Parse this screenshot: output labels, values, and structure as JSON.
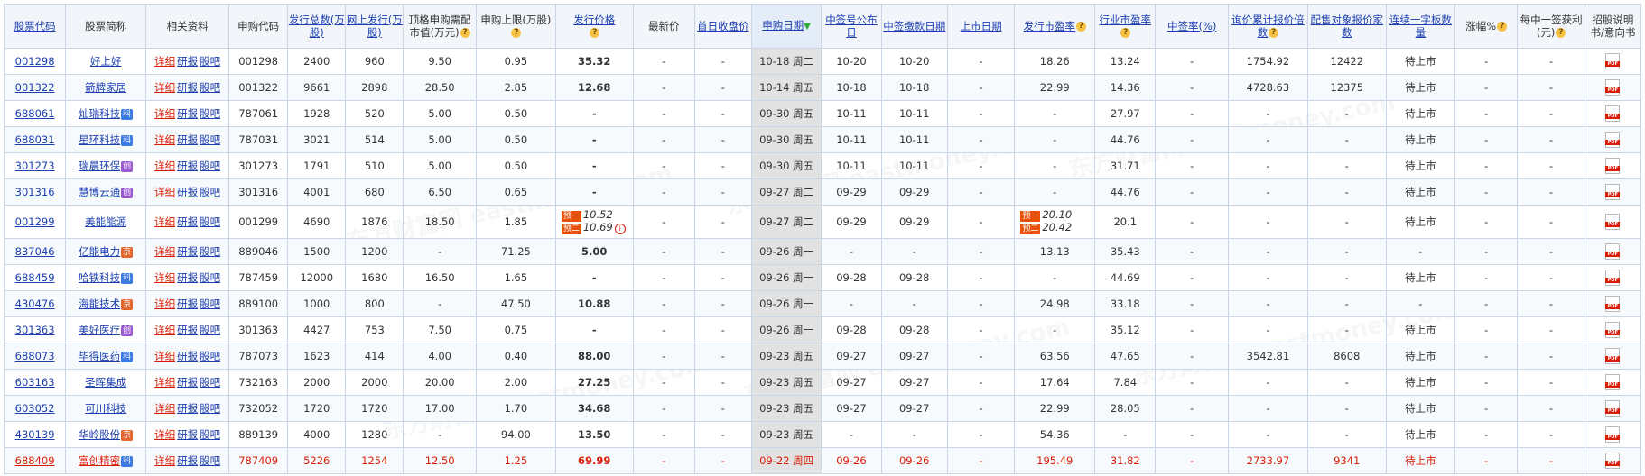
{
  "header": {
    "code": "股票代码",
    "name": "股票简称",
    "related": "相关资料",
    "sub_code": "申购代码",
    "issue_total": "发行总数(万股)",
    "online_issue": "网上发行(万股)",
    "top_sub_mv": "顶格申购需配市值(万元)",
    "sub_limit": "申购上限(万股)",
    "issue_price": "发行价格",
    "latest_price": "最新价",
    "first_close": "首日收盘价",
    "sub_date": "申购日期",
    "lot_pub_date": "中签号公布日",
    "pay_date": "中签缴款日期",
    "list_date": "上市日期",
    "issue_pe": "发行市盈率",
    "industry_pe": "行业市盈率",
    "lot_rate": "中签率(%)",
    "inquiry_mult": "询价累计报价倍数",
    "placement_count": "配售对象报价家数",
    "limit_boards": "连续一字板数量",
    "change_pct": "涨幅%",
    "profit_per_lot": "每中一签获利(元)",
    "prospectus": "招股说明书/意向书"
  },
  "related_links": {
    "detail": "详细",
    "report": "研报",
    "forum": "股吧"
  },
  "watermark": "东方财富网 eastmoney.com",
  "rows": [
    {
      "code": "001298",
      "name": "好上好",
      "tag": "",
      "sub": "001298",
      "total": "2400",
      "online": "960",
      "mv": "9.50",
      "limit": "0.95",
      "price": "35.32",
      "latest": "-",
      "first": "-",
      "date": "10-18 周二",
      "pub": "10-20",
      "pay": "10-20",
      "list": "-",
      "pe": "18.26",
      "ipe": "13.24",
      "rate": "-",
      "mult": "1754.92",
      "count": "12422",
      "boards": "待上市",
      "chg": "-",
      "profit": "-"
    },
    {
      "code": "001322",
      "name": "箭牌家居",
      "tag": "",
      "sub": "001322",
      "total": "9661",
      "online": "2898",
      "mv": "28.50",
      "limit": "2.85",
      "price": "12.68",
      "latest": "-",
      "first": "-",
      "date": "10-14 周五",
      "pub": "10-18",
      "pay": "10-18",
      "list": "-",
      "pe": "22.99",
      "ipe": "14.36",
      "rate": "-",
      "mult": "4728.63",
      "count": "12375",
      "boards": "待上市",
      "chg": "-",
      "profit": "-"
    },
    {
      "code": "688061",
      "name": "灿瑞科技",
      "tag": "科",
      "sub": "787061",
      "total": "1928",
      "online": "520",
      "mv": "5.00",
      "limit": "0.50",
      "price": "-",
      "latest": "-",
      "first": "-",
      "date": "09-30 周五",
      "pub": "10-11",
      "pay": "10-11",
      "list": "-",
      "pe": "-",
      "ipe": "27.97",
      "rate": "-",
      "mult": "-",
      "count": "-",
      "boards": "待上市",
      "chg": "-",
      "profit": "-"
    },
    {
      "code": "688031",
      "name": "星环科技",
      "tag": "科",
      "sub": "787031",
      "total": "3021",
      "online": "514",
      "mv": "5.00",
      "limit": "0.50",
      "price": "-",
      "latest": "-",
      "first": "-",
      "date": "09-30 周五",
      "pub": "10-11",
      "pay": "10-11",
      "list": "-",
      "pe": "-",
      "ipe": "44.76",
      "rate": "-",
      "mult": "-",
      "count": "-",
      "boards": "待上市",
      "chg": "-",
      "profit": "-"
    },
    {
      "code": "301273",
      "name": "瑞晨环保",
      "tag": "创",
      "sub": "301273",
      "total": "1791",
      "online": "510",
      "mv": "5.00",
      "limit": "0.50",
      "price": "-",
      "latest": "-",
      "first": "-",
      "date": "09-30 周五",
      "pub": "10-11",
      "pay": "10-11",
      "list": "-",
      "pe": "-",
      "ipe": "31.71",
      "rate": "-",
      "mult": "-",
      "count": "-",
      "boards": "待上市",
      "chg": "-",
      "profit": "-"
    },
    {
      "code": "301316",
      "name": "慧博云通",
      "tag": "创",
      "sub": "301316",
      "total": "4001",
      "online": "680",
      "mv": "6.50",
      "limit": "0.65",
      "price": "-",
      "latest": "-",
      "first": "-",
      "date": "09-27 周二",
      "pub": "09-29",
      "pay": "09-29",
      "list": "-",
      "pe": "-",
      "ipe": "44.76",
      "rate": "-",
      "mult": "-",
      "count": "-",
      "boards": "待上市",
      "chg": "-",
      "profit": "-"
    },
    {
      "code": "001299",
      "name": "美能能源",
      "tag": "",
      "sub": "001299",
      "total": "4690",
      "online": "1876",
      "mv": "18.50",
      "limit": "1.85",
      "price": "",
      "pre_label1": "预一",
      "pre_price1": "10.52",
      "pre_label2": "预二",
      "pre_price2": "10.69",
      "latest": "-",
      "first": "-",
      "date": "09-27 周二",
      "pub": "09-29",
      "pay": "09-29",
      "list": "-",
      "pe": "",
      "pre_pe1": "20.10",
      "pre_pe2": "20.42",
      "ipe": "20.1",
      "rate": "-",
      "mult": "-",
      "count": "-",
      "boards": "待上市",
      "chg": "-",
      "profit": "-"
    },
    {
      "code": "837046",
      "name": "亿能电力",
      "tag": "京",
      "sub": "889046",
      "total": "1500",
      "online": "1200",
      "mv": "-",
      "limit": "71.25",
      "price": "5.00",
      "latest": "-",
      "first": "-",
      "date": "09-26 周一",
      "pub": "-",
      "pay": "-",
      "list": "-",
      "pe": "13.13",
      "ipe": "35.43",
      "rate": "-",
      "mult": "-",
      "count": "-",
      "boards": "-",
      "chg": "-",
      "profit": "-"
    },
    {
      "code": "688459",
      "name": "哈铁科技",
      "tag": "科",
      "sub": "787459",
      "total": "12000",
      "online": "1680",
      "mv": "16.50",
      "limit": "1.65",
      "price": "-",
      "latest": "-",
      "first": "-",
      "date": "09-26 周一",
      "pub": "09-28",
      "pay": "09-28",
      "list": "-",
      "pe": "-",
      "ipe": "44.69",
      "rate": "-",
      "mult": "-",
      "count": "-",
      "boards": "待上市",
      "chg": "-",
      "profit": "-"
    },
    {
      "code": "430476",
      "name": "海能技术",
      "tag": "京",
      "sub": "889100",
      "total": "1000",
      "online": "800",
      "mv": "-",
      "limit": "47.50",
      "price": "10.88",
      "latest": "-",
      "first": "-",
      "date": "09-26 周一",
      "pub": "-",
      "pay": "-",
      "list": "-",
      "pe": "24.98",
      "ipe": "33.18",
      "rate": "-",
      "mult": "-",
      "count": "-",
      "boards": "-",
      "chg": "-",
      "profit": "-"
    },
    {
      "code": "301363",
      "name": "美好医疗",
      "tag": "创",
      "sub": "301363",
      "total": "4427",
      "online": "753",
      "mv": "7.50",
      "limit": "0.75",
      "price": "-",
      "latest": "-",
      "first": "-",
      "date": "09-26 周一",
      "pub": "09-28",
      "pay": "09-28",
      "list": "-",
      "pe": "-",
      "ipe": "35.12",
      "rate": "-",
      "mult": "-",
      "count": "-",
      "boards": "待上市",
      "chg": "-",
      "profit": "-"
    },
    {
      "code": "688073",
      "name": "毕得医药",
      "tag": "科",
      "sub": "787073",
      "total": "1623",
      "online": "414",
      "mv": "4.00",
      "limit": "0.40",
      "price": "88.00",
      "latest": "-",
      "first": "-",
      "date": "09-23 周五",
      "pub": "09-27",
      "pay": "09-27",
      "list": "-",
      "pe": "63.56",
      "ipe": "47.65",
      "rate": "-",
      "mult": "3542.81",
      "count": "8608",
      "boards": "待上市",
      "chg": "-",
      "profit": "-"
    },
    {
      "code": "603163",
      "name": "圣晖集成",
      "tag": "",
      "sub": "732163",
      "total": "2000",
      "online": "2000",
      "mv": "20.00",
      "limit": "2.00",
      "price": "27.25",
      "latest": "-",
      "first": "-",
      "date": "09-23 周五",
      "pub": "09-27",
      "pay": "09-27",
      "list": "-",
      "pe": "17.64",
      "ipe": "7.84",
      "rate": "-",
      "mult": "-",
      "count": "-",
      "boards": "待上市",
      "chg": "-",
      "profit": "-"
    },
    {
      "code": "603052",
      "name": "可川科技",
      "tag": "",
      "sub": "732052",
      "total": "1720",
      "online": "1720",
      "mv": "17.00",
      "limit": "1.70",
      "price": "34.68",
      "latest": "-",
      "first": "-",
      "date": "09-23 周五",
      "pub": "09-27",
      "pay": "09-27",
      "list": "-",
      "pe": "22.99",
      "ipe": "28.05",
      "rate": "-",
      "mult": "-",
      "count": "-",
      "boards": "待上市",
      "chg": "-",
      "profit": "-"
    },
    {
      "code": "430139",
      "name": "华岭股份",
      "tag": "京",
      "sub": "889139",
      "total": "4000",
      "online": "1280",
      "mv": "-",
      "limit": "94.00",
      "price": "13.50",
      "latest": "-",
      "first": "-",
      "date": "09-23 周五",
      "pub": "-",
      "pay": "-",
      "list": "-",
      "pe": "54.36",
      "ipe": "-",
      "rate": "-",
      "mult": "-",
      "count": "-",
      "boards": "待上市",
      "chg": "-",
      "profit": "-"
    },
    {
      "code": "688409",
      "name": "富创精密",
      "tag": "科",
      "sub": "787409",
      "total": "5226",
      "online": "1254",
      "mv": "12.50",
      "limit": "1.25",
      "price": "69.99",
      "latest": "-",
      "first": "-",
      "date": "09-22 周四",
      "pub": "09-26",
      "pay": "09-26",
      "list": "-",
      "pe": "195.49",
      "ipe": "31.82",
      "rate": "-",
      "mult": "2733.97",
      "count": "9341",
      "boards": "待上市",
      "chg": "-",
      "profit": "-",
      "highlight": true
    }
  ],
  "colors": {
    "link": "#1c3faf",
    "red": "#d81e06",
    "header_bg": "#f2f6fb",
    "border": "#c8d6e5",
    "date_col": "#e2e2e2"
  }
}
